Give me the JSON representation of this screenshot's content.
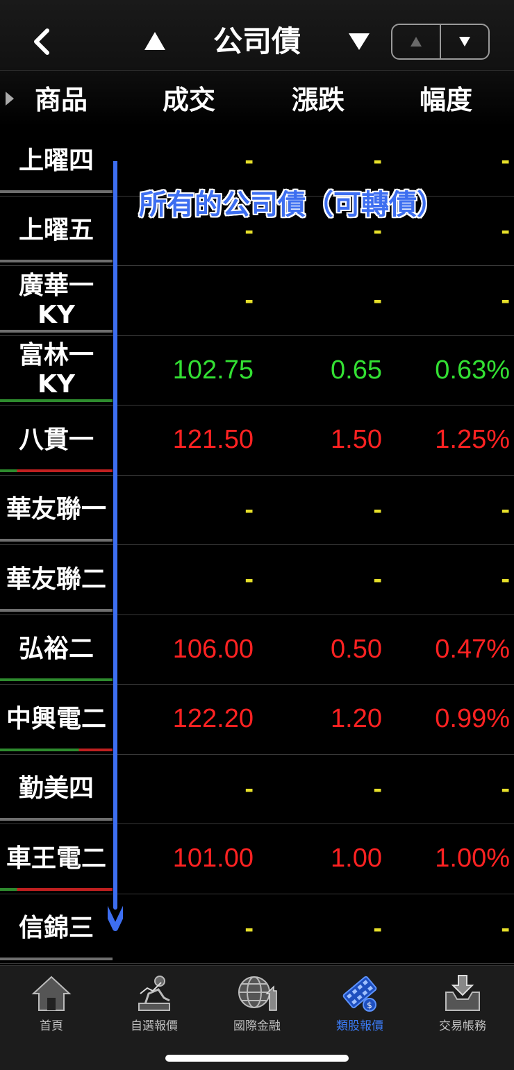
{
  "header": {
    "title": "公司債",
    "back_icon": "chevron-left-icon",
    "prev_category_icon": "triangle-up-icon",
    "next_category_icon": "triangle-down-icon",
    "segment": [
      "▲",
      "▼"
    ]
  },
  "columns": [
    "商品",
    "成交",
    "漲跌",
    "幅度"
  ],
  "rows": [
    {
      "name": "上曜四",
      "price": "-",
      "change": "-",
      "pct": "-",
      "dir": "none"
    },
    {
      "name": "上曜五",
      "price": "-",
      "change": "-",
      "pct": "-",
      "dir": "none"
    },
    {
      "name": "廣華一KY",
      "price": "-",
      "change": "-",
      "pct": "-",
      "dir": "none"
    },
    {
      "name": "富林一KY",
      "price": "102.75",
      "change": "0.65",
      "pct": "0.63%",
      "dir": "down"
    },
    {
      "name": "八貫一",
      "price": "121.50",
      "change": "1.50",
      "pct": "1.25%",
      "dir": "up"
    },
    {
      "name": "華友聯一",
      "price": "-",
      "change": "-",
      "pct": "-",
      "dir": "none"
    },
    {
      "name": "華友聯二",
      "price": "-",
      "change": "-",
      "pct": "-",
      "dir": "none"
    },
    {
      "name": "弘裕二",
      "price": "106.00",
      "change": "0.50",
      "pct": "0.47%",
      "dir": "up"
    },
    {
      "name": "中興電二",
      "price": "122.20",
      "change": "1.20",
      "pct": "0.99%",
      "dir": "up"
    },
    {
      "name": "勤美四",
      "price": "-",
      "change": "-",
      "pct": "-",
      "dir": "none"
    },
    {
      "name": "車王電二",
      "price": "101.00",
      "change": "1.00",
      "pct": "1.00%",
      "dir": "up"
    },
    {
      "name": "信錦三",
      "price": "-",
      "change": "-",
      "pct": "-",
      "dir": "none"
    }
  ],
  "annotation": "所有的公司債（可轉債）",
  "tabs": [
    {
      "label": "首頁",
      "icon": "home-icon",
      "active": false
    },
    {
      "label": "自選報價",
      "icon": "person-chart-icon",
      "active": false
    },
    {
      "label": "國際金融",
      "icon": "globe-icon",
      "active": false
    },
    {
      "label": "類股報價",
      "icon": "film-coin-icon",
      "active": true
    },
    {
      "label": "交易帳務",
      "icon": "inbox-download-icon",
      "active": false
    }
  ],
  "colors": {
    "up": "#ff2222",
    "down": "#33e033",
    "flat": "#e7e02a",
    "accent": "#3b7bf5"
  }
}
